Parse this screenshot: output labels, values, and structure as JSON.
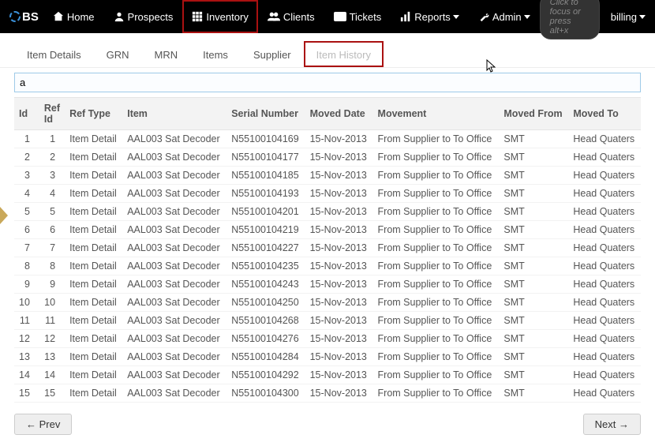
{
  "logo": "BS",
  "nav": {
    "home": "Home",
    "prospects": "Prospects",
    "inventory": "Inventory",
    "clients": "Clients",
    "tickets": "Tickets",
    "reports": "Reports",
    "admin": "Admin"
  },
  "search_placeholder": "Click to focus or press alt+x",
  "user": "billing",
  "tabs": {
    "item_details": "Item Details",
    "grn": "GRN",
    "mrn": "MRN",
    "items": "Items",
    "supplier": "Supplier",
    "item_history": "Item History"
  },
  "filter_value": "a",
  "table": {
    "headers": {
      "id": "Id",
      "ref_id": "Ref Id",
      "ref_type": "Ref Type",
      "item": "Item",
      "serial": "Serial Number",
      "moved_date": "Moved Date",
      "movement": "Movement",
      "moved_from": "Moved From",
      "moved_to": "Moved To"
    },
    "rows": [
      {
        "id": "1",
        "ref_id": "1",
        "ref_type": "Item Detail",
        "item": "AAL003 Sat Decoder",
        "serial": "N55100104169",
        "moved_date": "15-Nov-2013",
        "movement": "From Supplier to To Office",
        "moved_from": "SMT",
        "moved_to": "Head Quaters"
      },
      {
        "id": "2",
        "ref_id": "2",
        "ref_type": "Item Detail",
        "item": "AAL003 Sat Decoder",
        "serial": "N55100104177",
        "moved_date": "15-Nov-2013",
        "movement": "From Supplier to To Office",
        "moved_from": "SMT",
        "moved_to": "Head Quaters"
      },
      {
        "id": "3",
        "ref_id": "3",
        "ref_type": "Item Detail",
        "item": "AAL003 Sat Decoder",
        "serial": "N55100104185",
        "moved_date": "15-Nov-2013",
        "movement": "From Supplier to To Office",
        "moved_from": "SMT",
        "moved_to": "Head Quaters"
      },
      {
        "id": "4",
        "ref_id": "4",
        "ref_type": "Item Detail",
        "item": "AAL003 Sat Decoder",
        "serial": "N55100104193",
        "moved_date": "15-Nov-2013",
        "movement": "From Supplier to To Office",
        "moved_from": "SMT",
        "moved_to": "Head Quaters"
      },
      {
        "id": "5",
        "ref_id": "5",
        "ref_type": "Item Detail",
        "item": "AAL003 Sat Decoder",
        "serial": "N55100104201",
        "moved_date": "15-Nov-2013",
        "movement": "From Supplier to To Office",
        "moved_from": "SMT",
        "moved_to": "Head Quaters"
      },
      {
        "id": "6",
        "ref_id": "6",
        "ref_type": "Item Detail",
        "item": "AAL003 Sat Decoder",
        "serial": "N55100104219",
        "moved_date": "15-Nov-2013",
        "movement": "From Supplier to To Office",
        "moved_from": "SMT",
        "moved_to": "Head Quaters"
      },
      {
        "id": "7",
        "ref_id": "7",
        "ref_type": "Item Detail",
        "item": "AAL003 Sat Decoder",
        "serial": "N55100104227",
        "moved_date": "15-Nov-2013",
        "movement": "From Supplier to To Office",
        "moved_from": "SMT",
        "moved_to": "Head Quaters"
      },
      {
        "id": "8",
        "ref_id": "8",
        "ref_type": "Item Detail",
        "item": "AAL003 Sat Decoder",
        "serial": "N55100104235",
        "moved_date": "15-Nov-2013",
        "movement": "From Supplier to To Office",
        "moved_from": "SMT",
        "moved_to": "Head Quaters"
      },
      {
        "id": "9",
        "ref_id": "9",
        "ref_type": "Item Detail",
        "item": "AAL003 Sat Decoder",
        "serial": "N55100104243",
        "moved_date": "15-Nov-2013",
        "movement": "From Supplier to To Office",
        "moved_from": "SMT",
        "moved_to": "Head Quaters"
      },
      {
        "id": "10",
        "ref_id": "10",
        "ref_type": "Item Detail",
        "item": "AAL003 Sat Decoder",
        "serial": "N55100104250",
        "moved_date": "15-Nov-2013",
        "movement": "From Supplier to To Office",
        "moved_from": "SMT",
        "moved_to": "Head Quaters"
      },
      {
        "id": "11",
        "ref_id": "11",
        "ref_type": "Item Detail",
        "item": "AAL003 Sat Decoder",
        "serial": "N55100104268",
        "moved_date": "15-Nov-2013",
        "movement": "From Supplier to To Office",
        "moved_from": "SMT",
        "moved_to": "Head Quaters"
      },
      {
        "id": "12",
        "ref_id": "12",
        "ref_type": "Item Detail",
        "item": "AAL003 Sat Decoder",
        "serial": "N55100104276",
        "moved_date": "15-Nov-2013",
        "movement": "From Supplier to To Office",
        "moved_from": "SMT",
        "moved_to": "Head Quaters"
      },
      {
        "id": "13",
        "ref_id": "13",
        "ref_type": "Item Detail",
        "item": "AAL003 Sat Decoder",
        "serial": "N55100104284",
        "moved_date": "15-Nov-2013",
        "movement": "From Supplier to To Office",
        "moved_from": "SMT",
        "moved_to": "Head Quaters"
      },
      {
        "id": "14",
        "ref_id": "14",
        "ref_type": "Item Detail",
        "item": "AAL003 Sat Decoder",
        "serial": "N55100104292",
        "moved_date": "15-Nov-2013",
        "movement": "From Supplier to To Office",
        "moved_from": "SMT",
        "moved_to": "Head Quaters"
      },
      {
        "id": "15",
        "ref_id": "15",
        "ref_type": "Item Detail",
        "item": "AAL003 Sat Decoder",
        "serial": "N55100104300",
        "moved_date": "15-Nov-2013",
        "movement": "From Supplier to To Office",
        "moved_from": "SMT",
        "moved_to": "Head Quaters"
      }
    ]
  },
  "pager": {
    "prev": "← Prev",
    "next": "Next →"
  }
}
